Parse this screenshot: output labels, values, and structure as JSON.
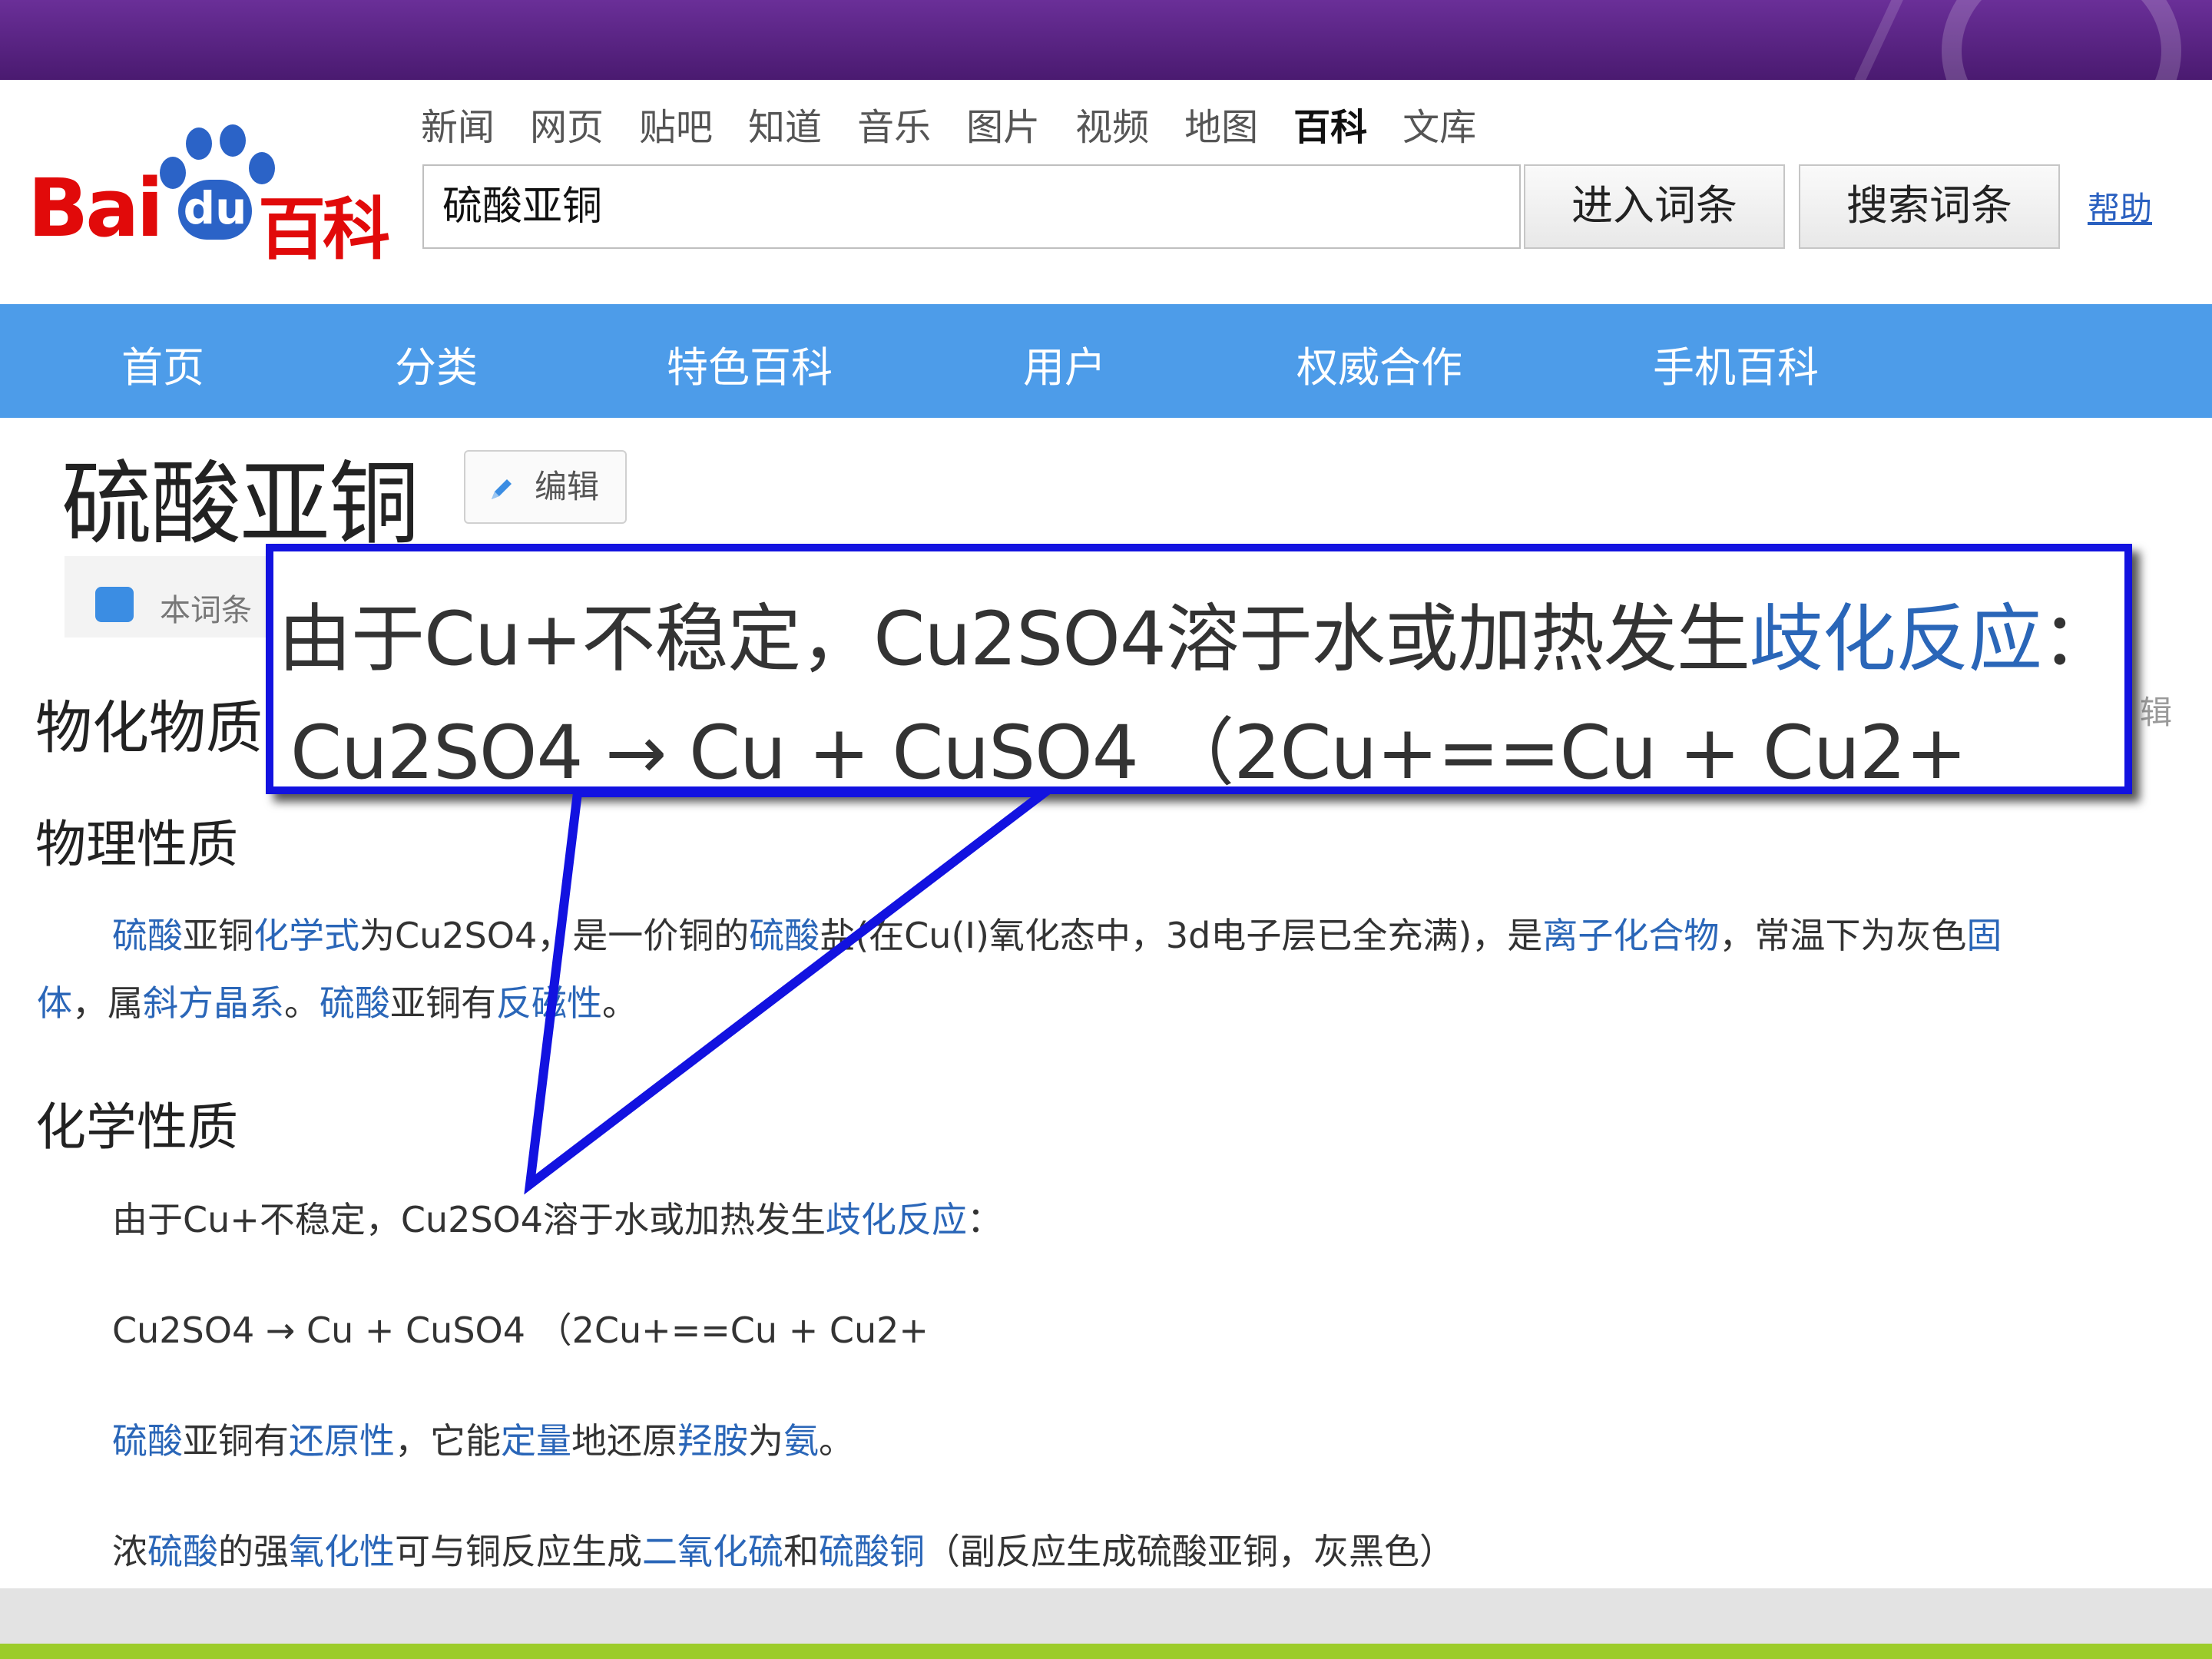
{
  "header": {
    "logo_text_bai": "Bai",
    "logo_text_du": "du",
    "logo_text_baike": "百科",
    "nav_links": [
      "新闻",
      "网页",
      "贴吧",
      "知道",
      "音乐",
      "图片",
      "视频",
      "地图",
      "百科",
      "文库"
    ],
    "active_nav": "百科",
    "search_value": "硫酸亚铜",
    "enter_button": "进入词条",
    "search_button": "搜索词条",
    "help_link": "帮助"
  },
  "main_nav": [
    "首页",
    "分类",
    "特色百科",
    "用户",
    "权威合作",
    "手机百科"
  ],
  "article": {
    "title": "硫酸亚铜",
    "edit_label": "编辑",
    "notice_text": "本词条",
    "section_title": "物化物质",
    "edit_right": "辑",
    "physical": {
      "heading": "物理性质",
      "line1": [
        {
          "t": "硫酸",
          "link": true
        },
        {
          "t": "亚铜",
          "link": false
        },
        {
          "t": "化学式",
          "link": true
        },
        {
          "t": "为Cu2SO4，是一价铜的",
          "link": false
        },
        {
          "t": "硫酸",
          "link": true
        },
        {
          "t": "盐(在Cu(I)氧化态中，3d电子层已全充满)，是",
          "link": false
        },
        {
          "t": "离子化合物",
          "link": true
        },
        {
          "t": "，常温下为灰色",
          "link": false
        },
        {
          "t": "固",
          "link": true
        }
      ],
      "line2": [
        {
          "t": "体",
          "link": true
        },
        {
          "t": "，属",
          "link": false
        },
        {
          "t": "斜方晶系",
          "link": true
        },
        {
          "t": "。",
          "link": false
        },
        {
          "t": "硫酸",
          "link": true
        },
        {
          "t": "亚铜有",
          "link": false
        },
        {
          "t": "反磁性",
          "link": true
        },
        {
          "t": "。",
          "link": false
        }
      ]
    },
    "chemical": {
      "heading": "化学性质",
      "p1": [
        {
          "t": "由于Cu+不稳定，Cu2SO4溶于水或加热发生",
          "link": false
        },
        {
          "t": "歧化反应",
          "link": true
        },
        {
          "t": "：",
          "link": false
        }
      ],
      "p2": "Cu2SO4 → Cu + CuSO4 （2Cu+==Cu + Cu2+",
      "p3": [
        {
          "t": "硫酸",
          "link": true
        },
        {
          "t": "亚铜有",
          "link": false
        },
        {
          "t": "还原性",
          "link": true
        },
        {
          "t": "，它能",
          "link": false
        },
        {
          "t": "定量",
          "link": true
        },
        {
          "t": "地还原",
          "link": false
        },
        {
          "t": "羟胺",
          "link": true
        },
        {
          "t": "为",
          "link": false
        },
        {
          "t": "氨",
          "link": true
        },
        {
          "t": "。",
          "link": false
        }
      ],
      "p4": [
        {
          "t": "浓",
          "link": false
        },
        {
          "t": "硫酸",
          "link": true
        },
        {
          "t": "的强",
          "link": false
        },
        {
          "t": "氧化性",
          "link": true
        },
        {
          "t": "可与铜反应生成",
          "link": false
        },
        {
          "t": "二氧化硫",
          "link": true
        },
        {
          "t": "和",
          "link": false
        },
        {
          "t": "硫酸铜",
          "link": true
        },
        {
          "t": "（副反应生成硫酸亚铜，灰黑色）",
          "link": false
        }
      ]
    }
  },
  "callout": {
    "line1": [
      {
        "t": "由于Cu+不稳定，Cu2SO4溶于水或加热发生",
        "link": false
      },
      {
        "t": "歧化反应",
        "link": true
      },
      {
        "t": "：",
        "link": false
      }
    ],
    "line2": "Cu2SO4 → Cu + CuSO4 （2Cu+==Cu + Cu2+"
  },
  "colors": {
    "callout_border": "#1212e0",
    "link": "#2a66b8",
    "nav_bar": "#4d9ce9",
    "top_band": "#5a2485",
    "logo_red": "#e10a0a",
    "logo_blue": "#2b63c7"
  }
}
